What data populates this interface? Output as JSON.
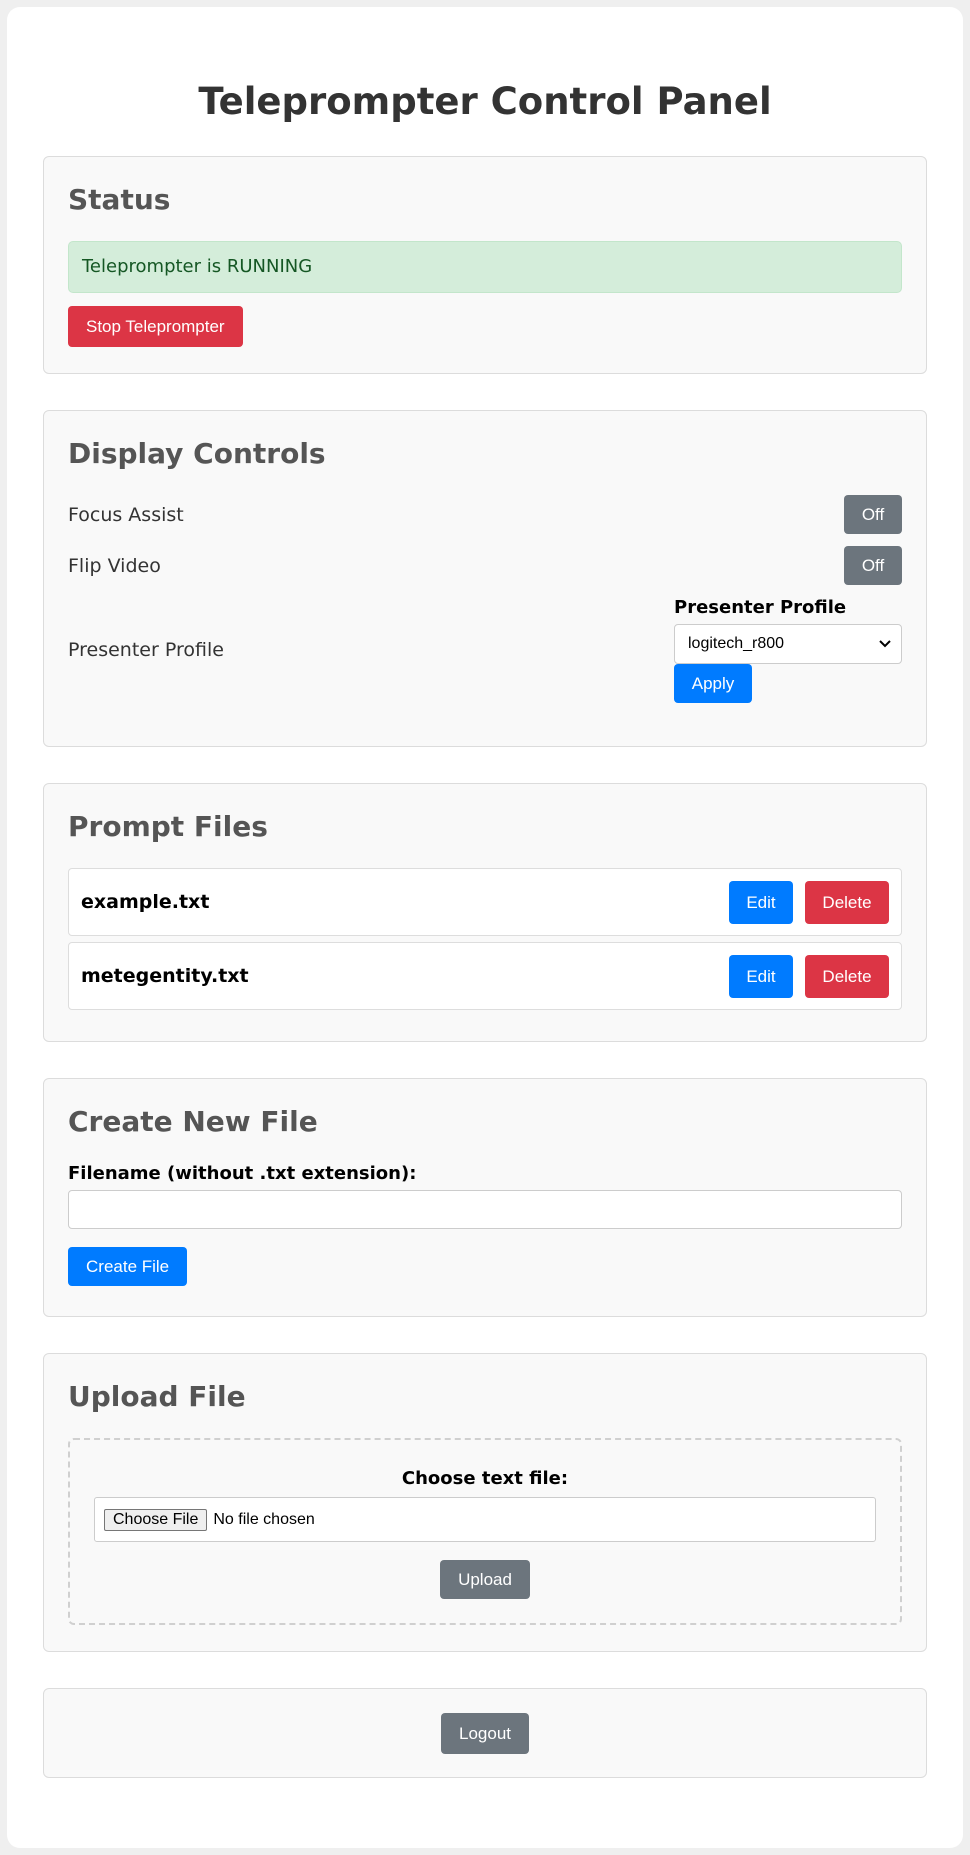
{
  "page": {
    "title": "Teleprompter Control Panel"
  },
  "status": {
    "heading": "Status",
    "message": "Teleprompter is RUNNING",
    "stop_label": "Stop Teleprompter"
  },
  "display": {
    "heading": "Display Controls",
    "focus_assist": {
      "label": "Focus Assist",
      "value": "Off"
    },
    "flip_video": {
      "label": "Flip Video",
      "value": "Off"
    },
    "presenter": {
      "label": "Presenter Profile",
      "field_label": "Presenter Profile",
      "selected": "logitech_r800",
      "apply_label": "Apply"
    }
  },
  "files": {
    "heading": "Prompt Files",
    "items": [
      {
        "name": "example.txt",
        "edit": "Edit",
        "delete": "Delete"
      },
      {
        "name": "metegentity.txt",
        "edit": "Edit",
        "delete": "Delete"
      }
    ]
  },
  "create": {
    "heading": "Create New File",
    "field_label": "Filename (without .txt extension):",
    "value": "",
    "button_label": "Create File"
  },
  "upload": {
    "heading": "Upload File",
    "field_label": "Choose text file:",
    "choose_label": "Choose File",
    "no_file": "No file chosen",
    "button_label": "Upload"
  },
  "logout": {
    "label": "Logout"
  },
  "colors": {
    "primary": "#007bff",
    "danger": "#dc3545",
    "secondary": "#6c757d",
    "success_bg": "#d4edda",
    "success_text": "#155724"
  }
}
